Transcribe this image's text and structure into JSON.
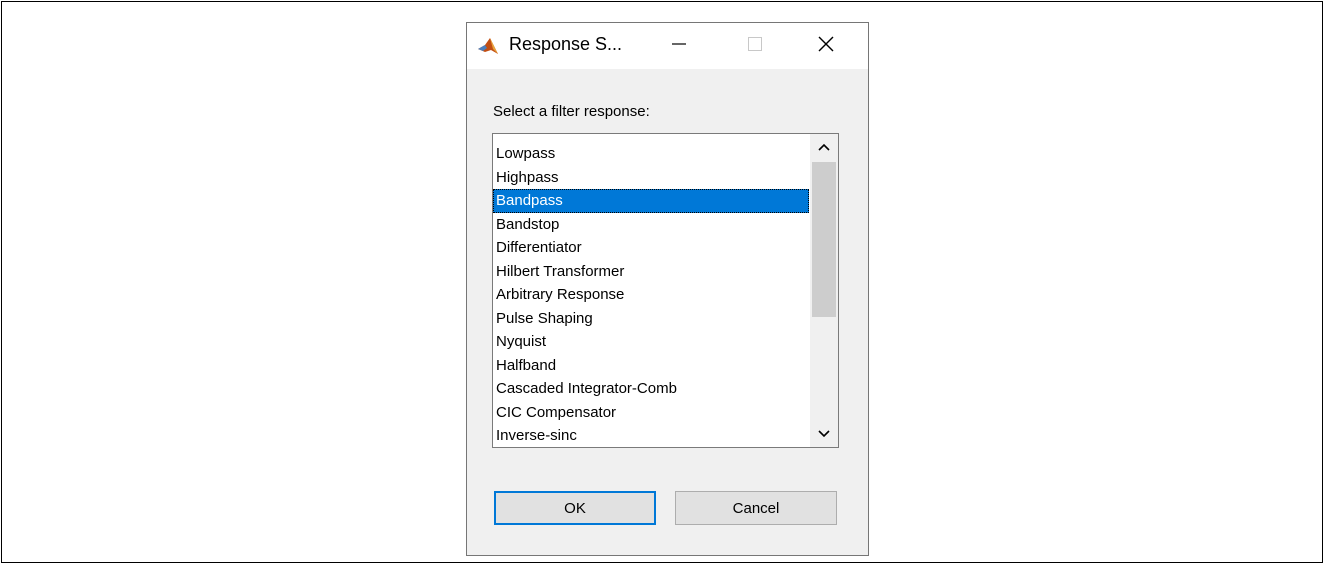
{
  "window": {
    "title": "Response S...",
    "icons": {
      "app": "matlab-logo-icon",
      "minimize": "minimize-icon",
      "maximize": "maximize-icon",
      "close": "close-icon"
    }
  },
  "prompt": "Select a filter response:",
  "list": {
    "items": [
      "Lowpass",
      "Highpass",
      "Bandpass",
      "Bandstop",
      "Differentiator",
      "Hilbert Transformer",
      "Arbitrary Response",
      "Pulse Shaping",
      "Nyquist",
      "Halfband",
      "Cascaded Integrator-Comb",
      "CIC Compensator",
      "Inverse-sinc"
    ],
    "selected": "Bandpass",
    "scroll_icons": {
      "up": "chevron-up-icon",
      "down": "chevron-down-icon"
    }
  },
  "buttons": {
    "ok": "OK",
    "cancel": "Cancel"
  },
  "colors": {
    "selection": "#0078d7",
    "dialog_background": "#f0f0f0",
    "default_button_border": "#0078d7"
  }
}
